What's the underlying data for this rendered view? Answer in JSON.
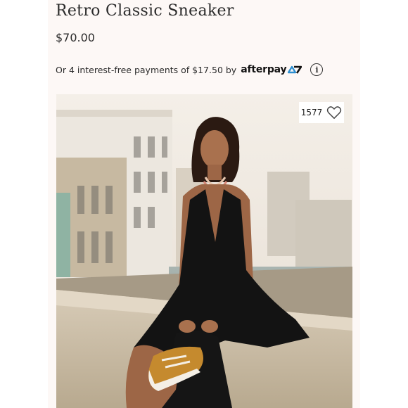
{
  "product": {
    "title": "Retro Classic Sneaker",
    "price": "$70.00"
  },
  "afterpay": {
    "prefix": "Or 4 interest-free payments of $17.50 by",
    "brand": "afterpay",
    "info_icon": "info-icon"
  },
  "likes": {
    "count": "1577",
    "icon": "heart-outline-icon"
  },
  "image": {
    "description_icon": "product-lifestyle-photo"
  },
  "colors": {
    "page_bg": "#fdf8f6",
    "afterpay_accent": "#2f8fd0",
    "text": "#2b2b2b"
  }
}
